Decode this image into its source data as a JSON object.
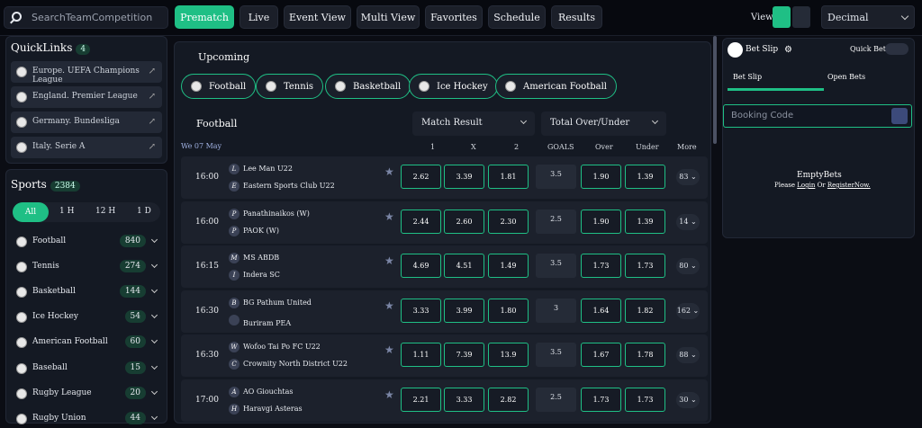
{
  "header": {
    "search_placeholder": "SearchTeamCompetition",
    "nav": [
      "Prematch",
      "Live",
      "Event View",
      "Multi View",
      "Favorites",
      "Schedule",
      "Results"
    ],
    "view_label": "View",
    "odds_format": "Decimal"
  },
  "quicklinks": {
    "title": "QuickLinks",
    "count": "4",
    "items": [
      "Europe. UEFA Champions League",
      "England. Premier League",
      "Germany. Bundesliga",
      "Italy. Serie A"
    ]
  },
  "sports": {
    "title": "Sports",
    "count": "2384",
    "filters": [
      "All",
      "1 H",
      "12 H",
      "1 D"
    ],
    "items": [
      {
        "name": "Football",
        "count": "840"
      },
      {
        "name": "Tennis",
        "count": "274"
      },
      {
        "name": "Basketball",
        "count": "144"
      },
      {
        "name": "Ice Hockey",
        "count": "54"
      },
      {
        "name": "American Football",
        "count": "60"
      },
      {
        "name": "Baseball",
        "count": "15"
      },
      {
        "name": "Rugby League",
        "count": "20"
      },
      {
        "name": "Rugby Union",
        "count": "44"
      }
    ]
  },
  "main": {
    "title": "Upcoming",
    "sport_tabs": [
      "Football",
      "Tennis",
      "Basketball",
      "Ice Hockey",
      "American Football"
    ],
    "section": "Football",
    "market": "Match Result",
    "market2": "Total Over/Under",
    "date": "We 07 May",
    "headers": [
      "1",
      "X",
      "2",
      "GOALS",
      "Over",
      "Under",
      "More"
    ],
    "events": [
      {
        "time": "16:00",
        "t1": "Lee Man U22",
        "b1": "L",
        "t2": "Eastern Sports Club U22",
        "b2": "E",
        "o": [
          "2.62",
          "3.39",
          "1.81"
        ],
        "goals": "3.5",
        "ov": "1.90",
        "un": "1.39",
        "more": "83"
      },
      {
        "time": "16:00",
        "t1": "Panathinaikos (W)",
        "b1": "P",
        "t2": "PAOK (W)",
        "b2": "P",
        "o": [
          "2.44",
          "2.60",
          "2.30"
        ],
        "goals": "2.5",
        "ov": "1.90",
        "un": "1.39",
        "more": "14"
      },
      {
        "time": "16:15",
        "t1": "MS ABDB",
        "b1": "M",
        "t2": "Indera SC",
        "b2": "I",
        "o": [
          "4.69",
          "4.51",
          "1.49"
        ],
        "goals": "3.5",
        "ov": "1.73",
        "un": "1.73",
        "more": "80"
      },
      {
        "time": "16:30",
        "t1": "BG Pathum United",
        "b1": "B",
        "t2": "Buriram PEA",
        "b2": "",
        "o": [
          "3.33",
          "3.99",
          "1.80"
        ],
        "goals": "3",
        "ov": "1.64",
        "un": "1.82",
        "more": "162"
      },
      {
        "time": "16:30",
        "t1": "Wofoo Tai Po FC U22",
        "b1": "W",
        "t2": "Crownity North District U22",
        "b2": "C",
        "o": [
          "1.11",
          "7.39",
          "13.9"
        ],
        "goals": "3.5",
        "ov": "1.67",
        "un": "1.78",
        "more": "88"
      },
      {
        "time": "17:00",
        "t1": "AO Giouchtas",
        "b1": "A",
        "t2": "Haravgi Asteras",
        "b2": "H",
        "o": [
          "2.21",
          "3.33",
          "2.82"
        ],
        "goals": "2.5",
        "ov": "1.73",
        "un": "1.73",
        "more": "30"
      }
    ]
  },
  "betslip": {
    "title": "Bet Slip",
    "quick_bet": "Quick Bet",
    "tabs": [
      "Bet Slip",
      "Open Bets"
    ],
    "booking_placeholder": "Booking Code",
    "empty_title": "EmptyBets",
    "empty_prefix": "Please",
    "login": "Login",
    "or": "Or",
    "register": "RegisterNow."
  }
}
